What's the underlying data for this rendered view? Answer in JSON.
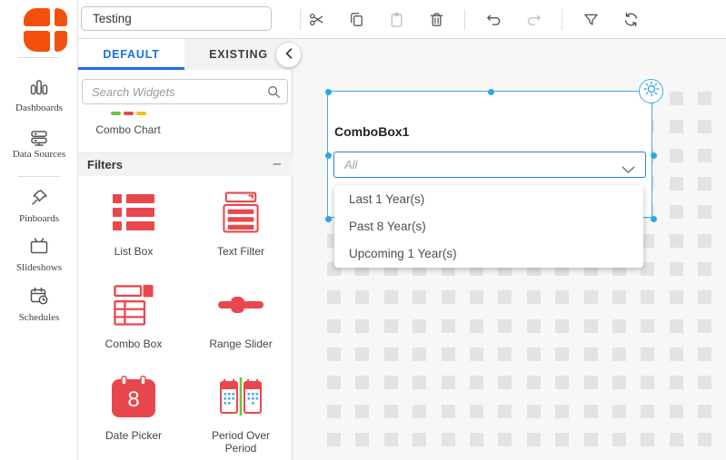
{
  "logo": {
    "color": "#f3500e"
  },
  "toolbar": {
    "dashboard_name": "Testing",
    "buttons": [
      {
        "id": "cut",
        "icon": "scissors-icon",
        "enabled": true,
        "divider_after": false
      },
      {
        "id": "copy",
        "icon": "copy-icon",
        "enabled": true,
        "divider_after": false
      },
      {
        "id": "paste",
        "icon": "clipboard-icon",
        "enabled": false,
        "divider_after": false
      },
      {
        "id": "delete",
        "icon": "trash-icon",
        "enabled": true,
        "divider_after": true
      },
      {
        "id": "undo",
        "icon": "undo-icon",
        "enabled": true,
        "divider_after": false
      },
      {
        "id": "redo",
        "icon": "redo-icon",
        "enabled": false,
        "divider_after": true
      },
      {
        "id": "filter",
        "icon": "funnel-icon",
        "enabled": true,
        "divider_after": false
      },
      {
        "id": "refresh",
        "icon": "refresh-icon",
        "enabled": true,
        "divider_after": false
      }
    ]
  },
  "sidebar": {
    "items": [
      {
        "label": "Dashboards",
        "icon": "bar-chart-icon"
      },
      {
        "label": "Data Sources",
        "icon": "server-icon"
      },
      {
        "label": "Pinboards",
        "icon": "pin-icon"
      },
      {
        "label": "Slideshows",
        "icon": "tv-icon"
      },
      {
        "label": "Schedules",
        "icon": "calendar-clock-icon"
      }
    ]
  },
  "widget_panel": {
    "tabs": [
      {
        "label": "DEFAULT",
        "active": true
      },
      {
        "label": "EXISTING",
        "active": false
      }
    ],
    "collapse_icon": "chevron-left-icon",
    "search_placeholder": "Search Widgets",
    "partial_item": {
      "label": "Combo Chart",
      "legend_colors": [
        "#72bf44",
        "#e8484d",
        "#f2c116"
      ]
    },
    "section": {
      "title": "Filters",
      "collapse_glyph": "–"
    },
    "widgets": [
      {
        "label": "List Box",
        "icon": "list-box-icon"
      },
      {
        "label": "Text Filter",
        "icon": "text-filter-icon"
      },
      {
        "label": "Combo Box",
        "icon": "combo-box-icon"
      },
      {
        "label": "Range Slider",
        "icon": "range-slider-icon"
      },
      {
        "label": "Date Picker",
        "icon": "date-picker-icon",
        "day": "8"
      },
      {
        "label": "Period Over Period",
        "icon": "period-over-period-icon"
      }
    ]
  },
  "canvas": {
    "widget": {
      "title": "ComboBox1",
      "placeholder": "All",
      "settings_icon": "gear-icon",
      "dropdown_options": [
        "Last 1 Year(s)",
        "Past 8 Year(s)",
        "Upcoming 1 Year(s)"
      ]
    }
  },
  "colors": {
    "accent_blue": "#1a6fe8",
    "selection_blue": "#45aae0",
    "widget_red": "#e8484d",
    "logo_orange": "#f3500e",
    "canvas_bg": "#f7f7f7",
    "grid_square": "#e3e3e3"
  }
}
